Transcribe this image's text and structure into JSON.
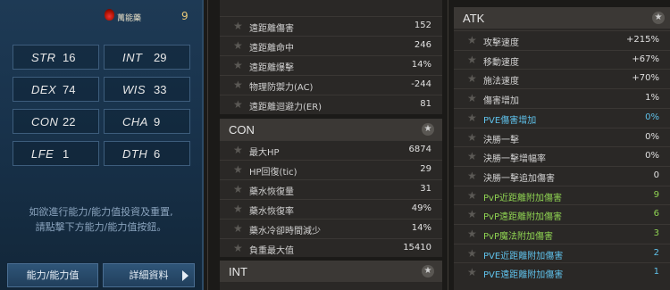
{
  "left": {
    "potion_label": "萬能藥",
    "potion_count": "9",
    "stats": [
      {
        "name": "STR",
        "value": "16"
      },
      {
        "name": "INT",
        "value": "29"
      },
      {
        "name": "DEX",
        "value": "74"
      },
      {
        "name": "WIS",
        "value": "33"
      },
      {
        "name": "CON",
        "value": "22"
      },
      {
        "name": "CHA",
        "value": "9"
      },
      {
        "name": "LFE",
        "value": "1"
      },
      {
        "name": "DTH",
        "value": "6"
      }
    ],
    "info_line1": "如欲進行能力/能力值投資及重置,",
    "info_line2": "請點擊下方能力/能力值按鈕。",
    "btn_ability": "能力/能力值",
    "btn_details": "詳細資料"
  },
  "middle": {
    "top_rows": [
      {
        "label": "遠距離傷害",
        "value": "152"
      },
      {
        "label": "遠距離命中",
        "value": "246"
      },
      {
        "label": "遠距離爆擊",
        "value": "14%"
      },
      {
        "label": "物理防禦力(AC)",
        "value": "-244"
      },
      {
        "label": "遠距離迴避力(ER)",
        "value": "81"
      }
    ],
    "con_title": "CON",
    "con_rows": [
      {
        "label": "最大HP",
        "value": "6874"
      },
      {
        "label": "HP回復(tic)",
        "value": "29"
      },
      {
        "label": "藥水恢復量",
        "value": "31"
      },
      {
        "label": "藥水恢復率",
        "value": "49%"
      },
      {
        "label": "藥水冷卻時間減少",
        "value": "14%"
      },
      {
        "label": "負重最大值",
        "value": "15410"
      }
    ],
    "int_title": "INT"
  },
  "right": {
    "atk_title": "ATK",
    "atk_rows": [
      {
        "label": "攻擊速度",
        "value": "+215%",
        "style": ""
      },
      {
        "label": "移動速度",
        "value": "+67%",
        "style": ""
      },
      {
        "label": "施法速度",
        "value": "+70%",
        "style": ""
      },
      {
        "label": "傷害增加",
        "value": "1%",
        "style": ""
      },
      {
        "label": "PVE傷害增加",
        "value": "0%",
        "style": "blue"
      },
      {
        "label": "決勝一擊",
        "value": "0%",
        "style": ""
      },
      {
        "label": "決勝一擊增幅率",
        "value": "0%",
        "style": ""
      },
      {
        "label": "決勝一擊追加傷害",
        "value": "0",
        "style": ""
      },
      {
        "label": "PvP近距離附加傷害",
        "value": "9",
        "style": "green"
      },
      {
        "label": "PvP遠距離附加傷害",
        "value": "6",
        "style": "green"
      },
      {
        "label": "PvP魔法附加傷害",
        "value": "3",
        "style": "green"
      },
      {
        "label": "PVE近距離附加傷害",
        "value": "2",
        "style": "blue"
      },
      {
        "label": "PVE遠距離附加傷害",
        "value": "1",
        "style": "blue"
      }
    ]
  }
}
